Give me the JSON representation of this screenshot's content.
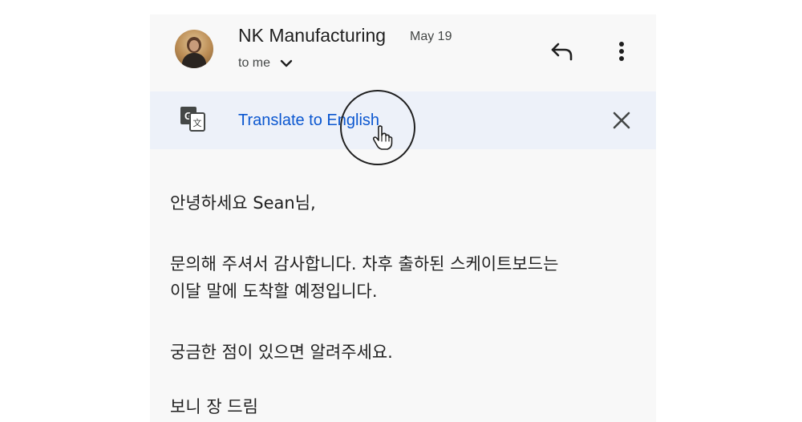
{
  "email": {
    "sender": "NK Manufacturing",
    "date": "May 19",
    "recipient": "to me",
    "icons": {
      "avatar": "sender-avatar",
      "recipient_toggle": "chevron-down-icon",
      "reply": "reply-icon",
      "more": "more-vert-icon"
    }
  },
  "translate_bar": {
    "link_label": "Translate to English",
    "icons": {
      "translate": "google-translate-icon",
      "close": "close-icon"
    },
    "accent_color": "#0b57d0",
    "background_color": "#edf1f9"
  },
  "body": {
    "greeting": "안녕하세요 Sean님,",
    "paragraph1_line1": "문의해 주셔서 감사합니다. 차후 출하된 스케이트보드는",
    "paragraph1_line2": "이달 말에 도착할 예정입니다.",
    "paragraph2": "궁금한 점이 있으면 알려주세요.",
    "signature": "보니 장 드림"
  }
}
